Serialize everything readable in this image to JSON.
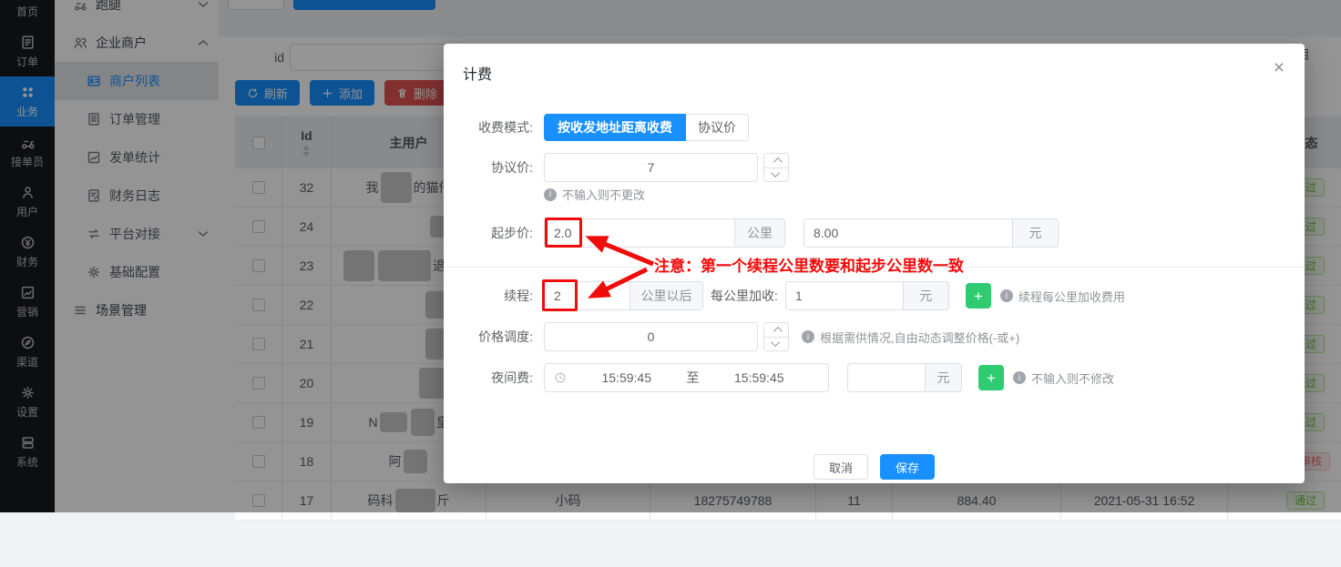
{
  "colors": {
    "accent": "#1890ff",
    "plus_green": "#2fcb70",
    "delete_red": "#e05252",
    "annotation_red": "#f10c0c",
    "badge_success": "#67c23a",
    "badge_danger": "#f56c6c"
  },
  "sidebar": {
    "rail": [
      {
        "id": "home",
        "label": "首页",
        "icon": "home",
        "first": true
      },
      {
        "id": "orders",
        "label": "订单",
        "icon": "doc"
      },
      {
        "id": "business",
        "label": "业务",
        "icon": "grid",
        "active": true
      },
      {
        "id": "couriers",
        "label": "接单员",
        "icon": "scooter"
      },
      {
        "id": "users",
        "label": "用户",
        "icon": "person"
      },
      {
        "id": "finance",
        "label": "财务",
        "icon": "coin"
      },
      {
        "id": "marketing",
        "label": "营销",
        "icon": "chart"
      },
      {
        "id": "channels",
        "label": "渠道",
        "icon": "compass"
      },
      {
        "id": "settings",
        "label": "设置",
        "icon": "gear"
      },
      {
        "id": "system",
        "label": "系统",
        "icon": "server"
      }
    ],
    "submenu": [
      {
        "id": "errand",
        "label": "跑腿",
        "icon": "scooter",
        "type": "group",
        "chevron": "down",
        "first": true
      },
      {
        "id": "enterprise-merchant",
        "label": "企业商户",
        "icon": "people",
        "type": "group",
        "chevron": "up"
      },
      {
        "id": "merchant-list",
        "label": "商户列表",
        "icon": "idcard",
        "type": "child",
        "active": true
      },
      {
        "id": "order-management",
        "label": "订单管理",
        "icon": "doclist",
        "type": "child"
      },
      {
        "id": "dispatch-stats",
        "label": "发单统计",
        "icon": "stats",
        "type": "child"
      },
      {
        "id": "finance-log",
        "label": "财务日志",
        "icon": "docedit",
        "type": "child"
      },
      {
        "id": "platform-connect",
        "label": "平台对接",
        "icon": "swap",
        "type": "child",
        "chevron": "down"
      },
      {
        "id": "basic-config",
        "label": "基础配置",
        "icon": "gear",
        "type": "child"
      },
      {
        "id": "scene-management",
        "label": "场景管理",
        "icon": "list",
        "type": "group"
      }
    ]
  },
  "search": {
    "id_label": "id",
    "partial_label": "目"
  },
  "actions": {
    "refresh": "刷新",
    "add": "添加",
    "delete": "删除"
  },
  "table": {
    "header": {
      "id": "Id",
      "main_user": "主用户",
      "status": "状态"
    },
    "rows": [
      {
        "id": "32",
        "segments": [
          {
            "t": "我"
          },
          {
            "blob": [
              34,
              34
            ]
          },
          {
            "t": "的猫仔"
          }
        ],
        "status": {
          "label": "通过",
          "type": "success"
        }
      },
      {
        "id": "24",
        "segments": [
          {
            "sp": 70
          },
          {
            "blob": [
              24,
              24
            ]
          }
        ],
        "status": {
          "label": "通过",
          "type": "success"
        }
      },
      {
        "id": "23",
        "segments": [
          {
            "blob": [
              34,
              34
            ]
          },
          {
            "blob": [
              58,
              34
            ]
          },
          {
            "t": "退-客服"
          }
        ],
        "status": {
          "label": "通过",
          "type": "success"
        }
      },
      {
        "id": "22",
        "segments": [
          {
            "sp": 66
          },
          {
            "blob": [
              30,
              30
            ]
          }
        ],
        "status": {
          "label": "通过",
          "type": "success"
        }
      },
      {
        "id": "21",
        "segments": [
          {
            "sp": 66
          },
          {
            "blob": [
              30,
              34
            ]
          }
        ],
        "status": {
          "label": "通过",
          "type": "success"
        }
      },
      {
        "id": "20",
        "segments": [
          {
            "sp": 60
          },
          {
            "blob": [
              38,
              34
            ]
          }
        ],
        "status": {
          "label": "通过",
          "type": "success"
        }
      },
      {
        "id": "19",
        "segments": [
          {
            "t": "N"
          },
          {
            "blob": [
              30,
              22
            ]
          },
          {
            "blob": [
              26,
              30
            ]
          },
          {
            "t": "皇"
          }
        ],
        "status": {
          "label": "通过",
          "type": "success"
        }
      },
      {
        "id": "18",
        "segments": [
          {
            "t": "阿"
          },
          {
            "blob": [
              26,
              26
            ]
          }
        ],
        "status": {
          "label": "待审核",
          "type": "danger"
        }
      },
      {
        "id": "17",
        "segments": [
          {
            "t": "码科"
          },
          {
            "blob": [
              44,
              26
            ]
          },
          {
            "t": "斤"
          }
        ],
        "cells": [
          "小码",
          "18275749788",
          "11",
          "884.40",
          "2021-05-31 16:52"
        ],
        "status": {
          "label": "通过",
          "type": "success"
        }
      }
    ]
  },
  "modal": {
    "title": "计费",
    "close": "×",
    "fields": {
      "mode": {
        "label": "收费模式:",
        "option_distance": "按收发地址距离收费",
        "option_protocol": "协议价",
        "selected": "按收发地址距离收费"
      },
      "protocol_price": {
        "label": "协议价:",
        "value": "7",
        "hint": "不输入则不更改"
      },
      "base_price": {
        "label": "起步价:",
        "km_value": "2.0",
        "km_unit": "公里",
        "price_value": "8.00",
        "price_unit": "元"
      },
      "annotation": "注意：第一个续程公里数要和起步公里数一致",
      "renew": {
        "label": "续程:",
        "km_value": "2",
        "km_unit": "公里以后",
        "per_km_label": "每公里加收:",
        "per_km_value": "1",
        "unit": "元",
        "hint": "续程每公里加收费用"
      },
      "price_adjust": {
        "label": "价格调度:",
        "value": "0",
        "hint": "根据需供情况,自由动态调整价格(-或+)"
      },
      "night_fee": {
        "label": "夜间费:",
        "time_start": "15:59:45",
        "time_sep": "至",
        "time_end": "15:59:45",
        "unit": "元",
        "hint": "不输入则不修改"
      }
    },
    "footer": {
      "cancel": "取消",
      "save": "保存"
    }
  }
}
